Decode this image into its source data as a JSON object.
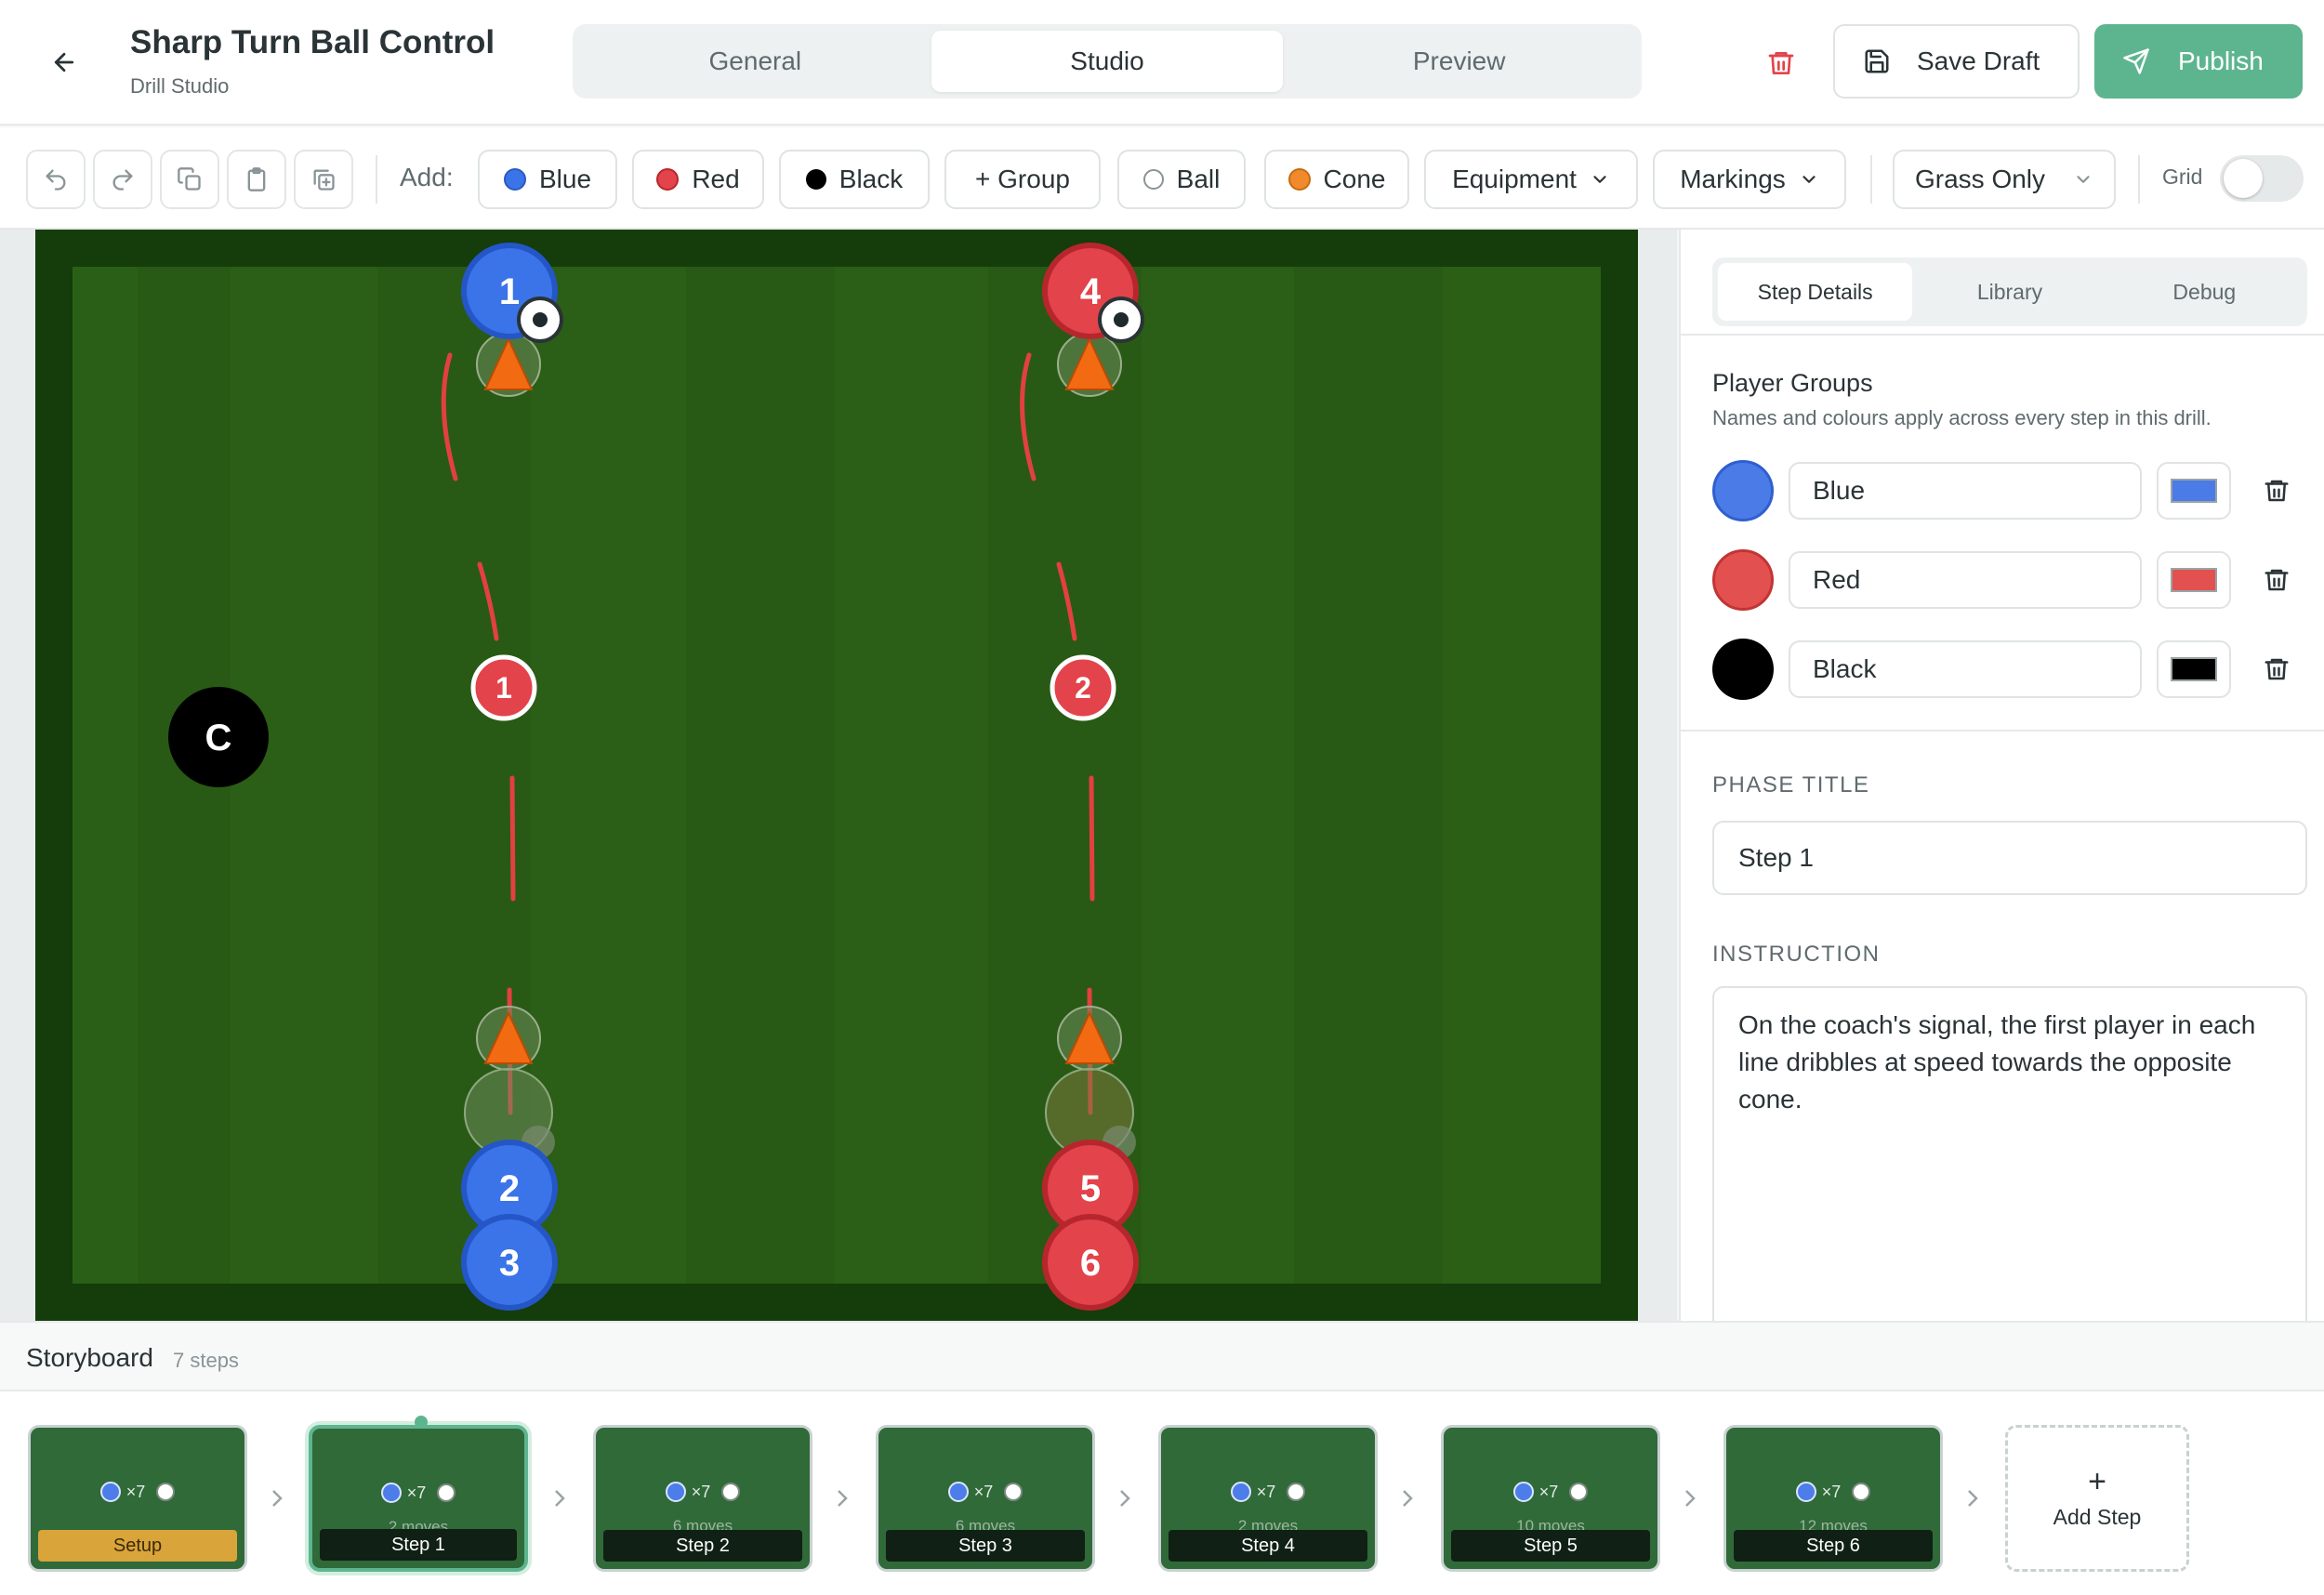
{
  "header": {
    "title": "Sharp Turn Ball Control",
    "subtitle": "Drill Studio",
    "tabs": [
      "General",
      "Studio",
      "Preview"
    ],
    "active_tab": "Studio",
    "save_label": "Save Draft",
    "publish_label": "Publish",
    "accent": "#5db58f"
  },
  "toolbar": {
    "add_label": "Add:",
    "blue_label": "Blue",
    "red_label": "Red",
    "black_label": "Black",
    "group_label": "+ Group",
    "ball_label": "Ball",
    "cone_label": "Cone",
    "equipment_label": "Equipment",
    "markings_label": "Markings",
    "surface_label": "Grass Only",
    "grid_label": "Grid",
    "grid_on": false
  },
  "pitch": {
    "players": [
      {
        "label": "1",
        "team": "blue"
      },
      {
        "label": "2",
        "team": "blue"
      },
      {
        "label": "3",
        "team": "blue"
      },
      {
        "label": "4",
        "team": "red"
      },
      {
        "label": "5",
        "team": "red"
      },
      {
        "label": "6",
        "team": "red"
      }
    ],
    "markers": [
      "1",
      "2"
    ],
    "coach_label": "C",
    "colors": {
      "blue": "#3b74e8",
      "red": "#e3434a",
      "black": "#000000",
      "cone": "#f26a12"
    }
  },
  "panel": {
    "tabs": [
      "Step Details",
      "Library",
      "Debug"
    ],
    "active_tab": "Step Details",
    "groups_title": "Player Groups",
    "groups_subtitle": "Names and colours apply across every step in this drill.",
    "groups": [
      {
        "name": "Blue",
        "color": "#4a7be6"
      },
      {
        "name": "Red",
        "color": "#e2514f"
      },
      {
        "name": "Black",
        "color": "#000000"
      }
    ],
    "phase_title_label": "PHASE TITLE",
    "phase_title_value": "Step 1",
    "instruction_label": "INSTRUCTION",
    "instruction_value": "On the coach's signal, the first player in each line dribbles at speed towards the opposite cone."
  },
  "storyboard": {
    "title": "Storyboard",
    "count": "7 steps",
    "steps": [
      {
        "label": "Setup",
        "players": "×7",
        "moves": ""
      },
      {
        "label": "Step 1",
        "players": "×7",
        "moves": "2 moves"
      },
      {
        "label": "Step 2",
        "players": "×7",
        "moves": "6 moves"
      },
      {
        "label": "Step 3",
        "players": "×7",
        "moves": "6 moves"
      },
      {
        "label": "Step 4",
        "players": "×7",
        "moves": "2 moves"
      },
      {
        "label": "Step 5",
        "players": "×7",
        "moves": "10 moves"
      },
      {
        "label": "Step 6",
        "players": "×7",
        "moves": "12 moves"
      }
    ],
    "active_index": 1,
    "add_label": "Add Step"
  }
}
